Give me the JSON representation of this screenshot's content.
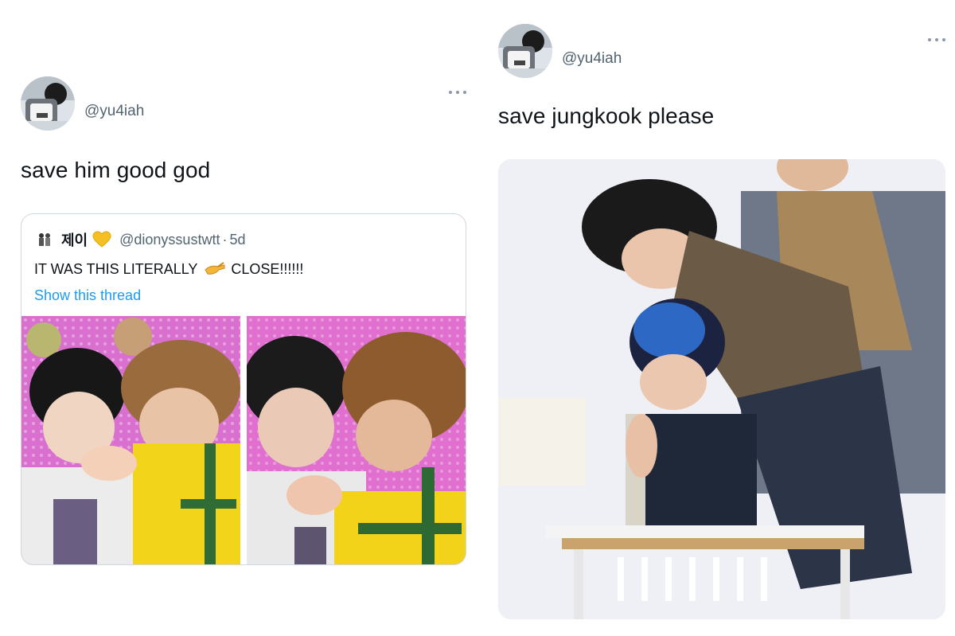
{
  "tweets": [
    {
      "handle": "@yu4iah",
      "text": "save him good god",
      "quote": {
        "name": "제이",
        "handle": "@dionyssustwtt",
        "separator": "·",
        "time": "5d",
        "text_before": "IT WAS THIS LITERALLY",
        "text_after": "CLOSE!!!!!!",
        "show_thread": "Show this thread"
      }
    },
    {
      "handle": "@yu4iah",
      "text": "save jungkook please"
    }
  ],
  "icons": {
    "more": "more-horizontal-icon",
    "heart": "yellow-heart-icon",
    "hand": "pinching-hand-icon"
  },
  "colors": {
    "text": "#0f1419",
    "secondary": "#536471",
    "link": "#1d9bf0",
    "border": "#cfd9de",
    "heart": "#f5c023"
  }
}
